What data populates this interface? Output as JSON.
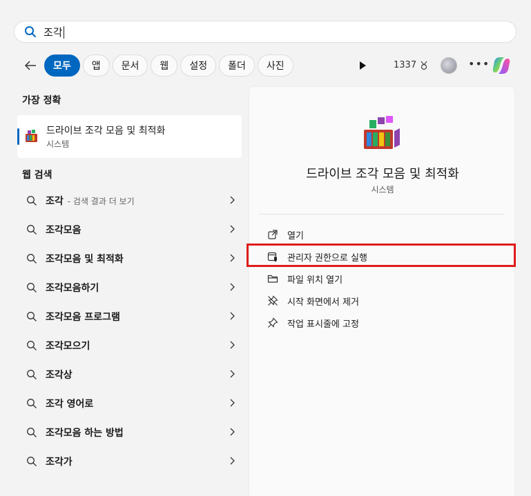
{
  "search": {
    "query": "조각"
  },
  "filters": {
    "tabs": [
      "모두",
      "앱",
      "문서",
      "웹",
      "설정",
      "폴더",
      "사진"
    ],
    "points": "1337"
  },
  "best_match": {
    "heading": "가장 정확",
    "title": "드라이브 조각 모음 및 최적화",
    "subtitle": "시스템"
  },
  "web_search": {
    "heading": "웹 검색",
    "items": [
      {
        "label": "조각",
        "suffix": "- 검색 결과 더 보기"
      },
      {
        "label": "조각모음",
        "suffix": ""
      },
      {
        "label": "조각모음 및 최적화",
        "suffix": ""
      },
      {
        "label": "조각모음하기",
        "suffix": ""
      },
      {
        "label": "조각모음 프로그램",
        "suffix": ""
      },
      {
        "label": "조각모으기",
        "suffix": ""
      },
      {
        "label": "조각상",
        "suffix": ""
      },
      {
        "label": "조각 영어로",
        "suffix": ""
      },
      {
        "label": "조각모음 하는 방법",
        "suffix": ""
      },
      {
        "label": "조각가",
        "suffix": ""
      }
    ]
  },
  "detail": {
    "title": "드라이브 조각 모음 및 최적화",
    "subtitle": "시스템",
    "actions": [
      {
        "label": "열기",
        "icon": "open-external-icon"
      },
      {
        "label": "관리자 권한으로 실행",
        "icon": "admin-shield-icon"
      },
      {
        "label": "파일 위치 열기",
        "icon": "folder-icon"
      },
      {
        "label": "시작 화면에서 제거",
        "icon": "unpin-icon"
      },
      {
        "label": "작업 표시줄에 고정",
        "icon": "pin-icon"
      }
    ]
  },
  "colors": {
    "accent": "#0067c0",
    "highlight": "#e01a1a"
  }
}
